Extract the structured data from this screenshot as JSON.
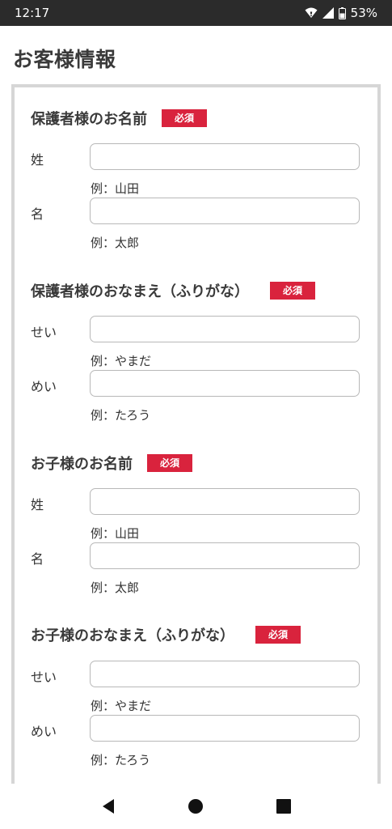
{
  "status_bar": {
    "time": "12:17",
    "battery": "53%"
  },
  "page_title": "お客様情報",
  "required_label": "必須",
  "sections": [
    {
      "title": "保護者様のお名前",
      "fields": [
        {
          "label": "姓",
          "hint": "例：山田"
        },
        {
          "label": "名",
          "hint": "例：太郎"
        }
      ]
    },
    {
      "title": "保護者様のおなまえ（ふりがな）",
      "fields": [
        {
          "label": "せい",
          "hint": "例：やまだ"
        },
        {
          "label": "めい",
          "hint": "例：たろう"
        }
      ]
    },
    {
      "title": "お子様のお名前",
      "fields": [
        {
          "label": "姓",
          "hint": "例：山田"
        },
        {
          "label": "名",
          "hint": "例：太郎"
        }
      ]
    },
    {
      "title": "お子様のおなまえ（ふりがな）",
      "fields": [
        {
          "label": "せい",
          "hint": "例：やまだ"
        },
        {
          "label": "めい",
          "hint": "例：たろう"
        }
      ]
    }
  ],
  "colors": {
    "required_badge": "#d9233d",
    "status_bar": "#2b2b2b",
    "box_border": "#d6d6d6"
  },
  "icons": [
    "wifi-icon",
    "signal-icon",
    "battery-icon",
    "back-icon",
    "home-icon",
    "recents-icon"
  ]
}
